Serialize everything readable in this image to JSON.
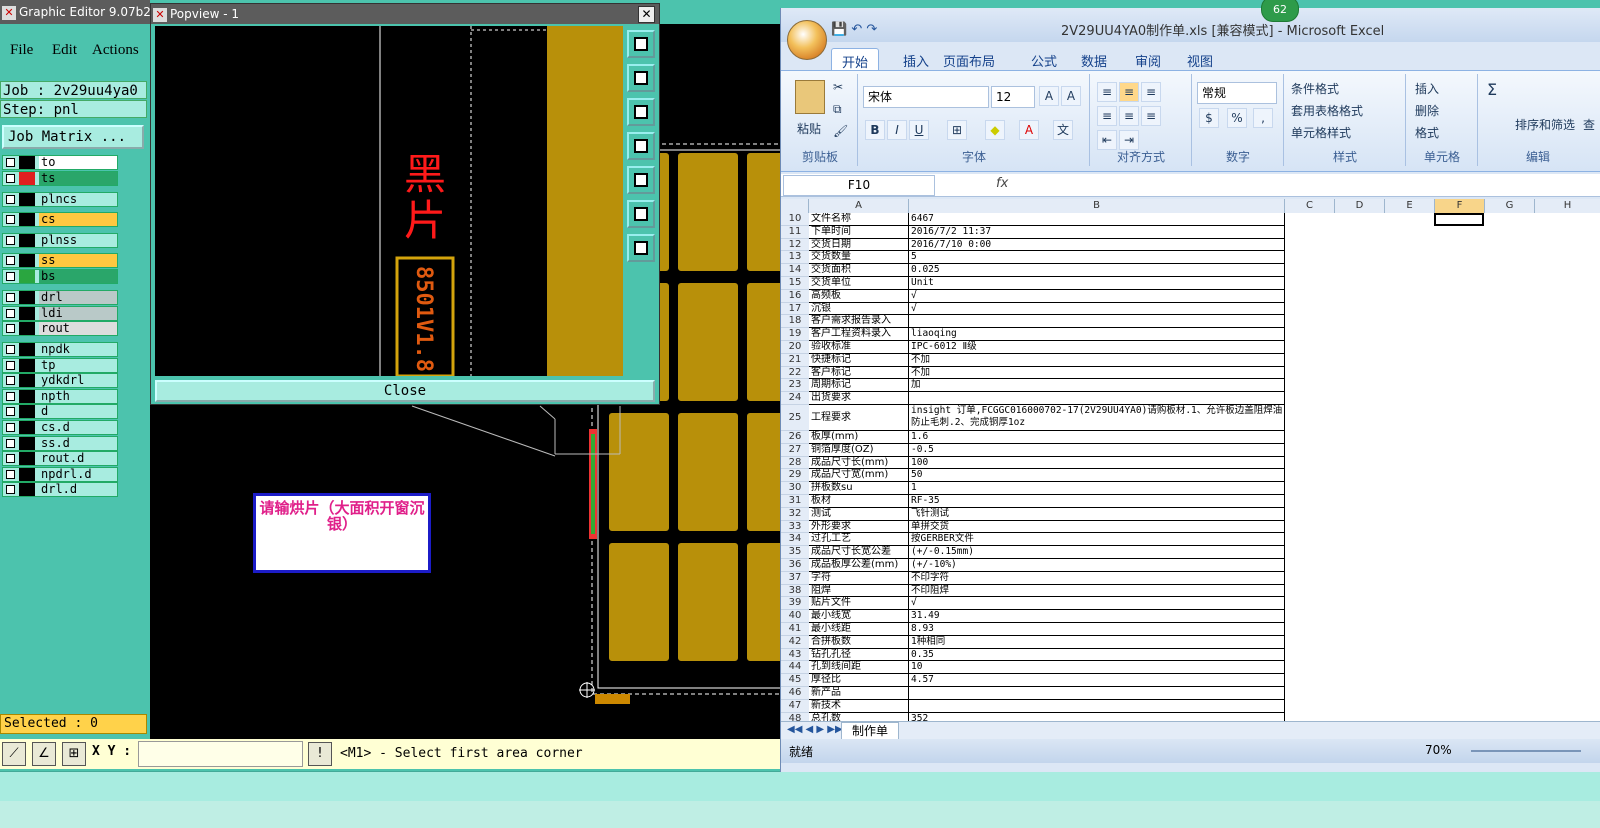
{
  "genesis": {
    "title": "Graphic Editor 9.07b2 (0",
    "menu": [
      "File",
      "Edit",
      "Actions"
    ],
    "job": "Job : 2v29uu4ya0",
    "step": "Step: pnl",
    "job_matrix": "Job Matrix ...",
    "layers": [
      {
        "name": "to",
        "color": "#ffffff",
        "swatch": "#000000"
      },
      {
        "name": "ts",
        "color": "#2aa66a",
        "swatch": "#e02020"
      },
      {
        "name": "plncs",
        "color": "#a8ece0",
        "swatch": "#000000"
      },
      {
        "name": "cs",
        "color": "#ffc840",
        "swatch": "#000000"
      },
      {
        "name": "plnss",
        "color": "#a8ece0",
        "swatch": "#000000"
      },
      {
        "name": "ss",
        "color": "#ffc840",
        "swatch": "#000000"
      },
      {
        "name": "bs",
        "color": "#2aa66a",
        "swatch": "#2aa640"
      },
      {
        "name": "drl",
        "color": "#b9c9c8",
        "swatch": "#000000"
      },
      {
        "name": "ldi",
        "color": "#b9c9c8",
        "swatch": "#000000"
      },
      {
        "name": "rout",
        "color": "#dddddd",
        "swatch": "#000000"
      },
      {
        "name": "npdk",
        "color": "#a8ece0",
        "swatch": "#000000"
      },
      {
        "name": "tp",
        "color": "#a8ece0",
        "swatch": "#000000"
      },
      {
        "name": "ydkdrl",
        "color": "#a8ece0",
        "swatch": "#000000"
      },
      {
        "name": "npth",
        "color": "#a8ece0",
        "swatch": "#000000"
      },
      {
        "name": "d",
        "color": "#a8ece0",
        "swatch": "#000000"
      },
      {
        "name": "cs.d",
        "color": "#a8ece0",
        "swatch": "#000000"
      },
      {
        "name": "ss.d",
        "color": "#a8ece0",
        "swatch": "#000000"
      },
      {
        "name": "rout.d",
        "color": "#a8ece0",
        "swatch": "#000000"
      },
      {
        "name": "npdrl.d",
        "color": "#a8ece0",
        "swatch": "#000000"
      },
      {
        "name": "drl.d",
        "color": "#a8ece0",
        "swatch": "#000000"
      }
    ],
    "selected": "Selected : 0",
    "xy_label": "X Y :",
    "status_message": "<M1> - Select first area corner",
    "annotation": "请输烘片（大面积开窗沉银）"
  },
  "popview": {
    "title": "Popview - 1",
    "close_button": "Close",
    "vertical_text": "黑片",
    "vertical_code": "8501V1.8"
  },
  "excel": {
    "title": "2V29UU4YA0制作单.xls  [兼容模式] - Microsoft Excel",
    "badge": "62",
    "tabs": [
      "开始",
      "插入",
      "页面布局",
      "公式",
      "数据",
      "审阅",
      "视图"
    ],
    "ribbon": {
      "paste": "粘贴",
      "clipboard": "剪贴板",
      "font_name": "宋体",
      "font_size": "12",
      "font_group": "字体",
      "align_group": "对齐方式",
      "number_format": "常规",
      "number_group": "数字",
      "cond_format": "条件格式",
      "table_format": "套用表格格式",
      "cell_style": "单元格样式",
      "style_group": "样式",
      "insert": "插入",
      "delete": "删除",
      "format": "格式",
      "cells_group": "单元格",
      "sort_filter": "排序和筛选",
      "find": "查",
      "edit_group": "编辑"
    },
    "name_box": "F10",
    "fx": "fx",
    "columns": [
      "A",
      "B",
      "C",
      "D",
      "E",
      "F",
      "G",
      "H"
    ],
    "rows": [
      {
        "n": "10",
        "a": "文件名称",
        "b": "6467"
      },
      {
        "n": "11",
        "a": "下单时间",
        "b": "2016/7/2 11:37"
      },
      {
        "n": "12",
        "a": "交货日期",
        "b": "2016/7/10 0:00"
      },
      {
        "n": "13",
        "a": "交货数量",
        "b": "5"
      },
      {
        "n": "14",
        "a": "交货面积",
        "b": "0.025"
      },
      {
        "n": "15",
        "a": "交货单位",
        "b": "Unit"
      },
      {
        "n": "16",
        "a": "高频板",
        "b": "√"
      },
      {
        "n": "17",
        "a": "沉银",
        "b": "√"
      },
      {
        "n": "18",
        "a": "客户需求报告录入",
        "b": ""
      },
      {
        "n": "19",
        "a": "客户工程资料录入",
        "b": "liaoqing"
      },
      {
        "n": "20",
        "a": "验收标准",
        "b": "IPC-6012 Ⅱ级"
      },
      {
        "n": "21",
        "a": "快捷标记",
        "b": "不加"
      },
      {
        "n": "22",
        "a": "客户标记",
        "b": "不加"
      },
      {
        "n": "23",
        "a": "周期标记",
        "b": "加"
      },
      {
        "n": "24",
        "a": "出货要求",
        "b": ""
      },
      {
        "n": "25",
        "a": "工程要求",
        "b": "insight 订单,FCGGC016000702-17(2V29UU4YA0)请购板材.1、允许板边盖阻焊油防止毛刺.2、完成铜厚1oz",
        "tall": true
      },
      {
        "n": "26",
        "a": "板厚(mm)",
        "b": "1.6"
      },
      {
        "n": "27",
        "a": "铜箔厚度(OZ)",
        "b": "-0.5"
      },
      {
        "n": "28",
        "a": "成品尺寸长(mm)",
        "b": "100"
      },
      {
        "n": "29",
        "a": "成品尺寸宽(mm)",
        "b": "50"
      },
      {
        "n": "30",
        "a": "拼板数su",
        "b": "1"
      },
      {
        "n": "31",
        "a": "板材",
        "b": "RF-35"
      },
      {
        "n": "32",
        "a": "测试",
        "b": "飞针测试"
      },
      {
        "n": "33",
        "a": "外形要求",
        "b": "单拼交货"
      },
      {
        "n": "34",
        "a": "过孔工艺",
        "b": "按GERBER文件"
      },
      {
        "n": "35",
        "a": "成品尺寸长宽公差",
        "b": "(+/-0.15mm)"
      },
      {
        "n": "36",
        "a": "成品板厚公差(mm)",
        "b": "(+/-10%)"
      },
      {
        "n": "37",
        "a": "字符",
        "b": "不印字符"
      },
      {
        "n": "38",
        "a": "阻焊",
        "b": "不印阻焊"
      },
      {
        "n": "39",
        "a": "贴片文件",
        "b": "√"
      },
      {
        "n": "40",
        "a": "最小线宽",
        "b": "31.49"
      },
      {
        "n": "41",
        "a": "最小线距",
        "b": "8.93"
      },
      {
        "n": "42",
        "a": "合拼板数",
        "b": "1种相同"
      },
      {
        "n": "43",
        "a": "钻孔孔径",
        "b": "0.35"
      },
      {
        "n": "44",
        "a": "孔到线间距",
        "b": "10"
      },
      {
        "n": "45",
        "a": "厚径比",
        "b": "4.57"
      },
      {
        "n": "46",
        "a": "新产品",
        "b": ""
      },
      {
        "n": "47",
        "a": "新技术",
        "b": ""
      },
      {
        "n": "48",
        "a": "总孔数",
        "b": "352"
      }
    ],
    "sheet_tab": "制作单",
    "status": "就绪",
    "zoom": "70%"
  }
}
